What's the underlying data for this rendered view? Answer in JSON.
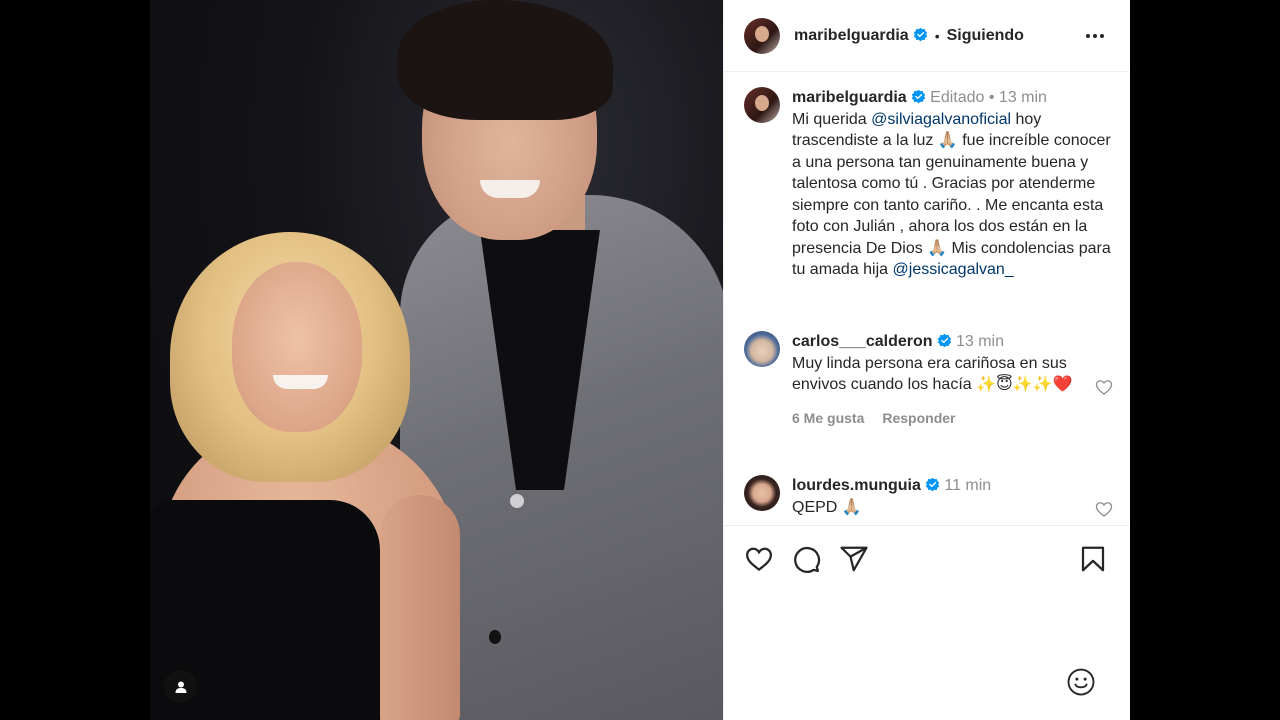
{
  "header": {
    "username": "maribelguardia",
    "follow_state": "Siguiendo"
  },
  "caption": {
    "username": "maribelguardia",
    "edited": "Editado",
    "time": "13 min",
    "text_before": "Mi querida ",
    "mention_1": "@silviagalvanoficial",
    "text_middle": " hoy trascendiste a la luz 🙏🏼 fue increíble conocer a una persona tan genuinamente buena y talentosa como tú . Gracias por atenderme siempre con tanto cariño. . Me encanta esta foto con Julián , ahora los dos están en la presencia De Dios 🙏🏼 Mis condolencias para tu amada hija ",
    "mention_2": "@jessicagalvan_"
  },
  "comments": [
    {
      "username": "carlos___calderon",
      "time": "13 min",
      "text": "Muy linda persona era cariñosa en sus envivos cuando los hacía ✨😇✨✨❤️",
      "likes": "6 Me gusta",
      "reply": "Responder"
    },
    {
      "username": "lourdes.munguia",
      "time": "11 min",
      "text": "QEPD 🙏🏼"
    }
  ],
  "icons": {
    "verified": "verified-badge-icon",
    "more": "more-options-icon",
    "like": "heart-icon",
    "comment": "comment-icon",
    "share": "paper-plane-icon",
    "save": "bookmark-icon",
    "emoji": "emoji-icon",
    "user_tag": "user-tag-icon"
  },
  "colors": {
    "verified_blue": "#0095f6",
    "mention_blue": "#00376b",
    "muted_gray": "#8e8e8e"
  }
}
